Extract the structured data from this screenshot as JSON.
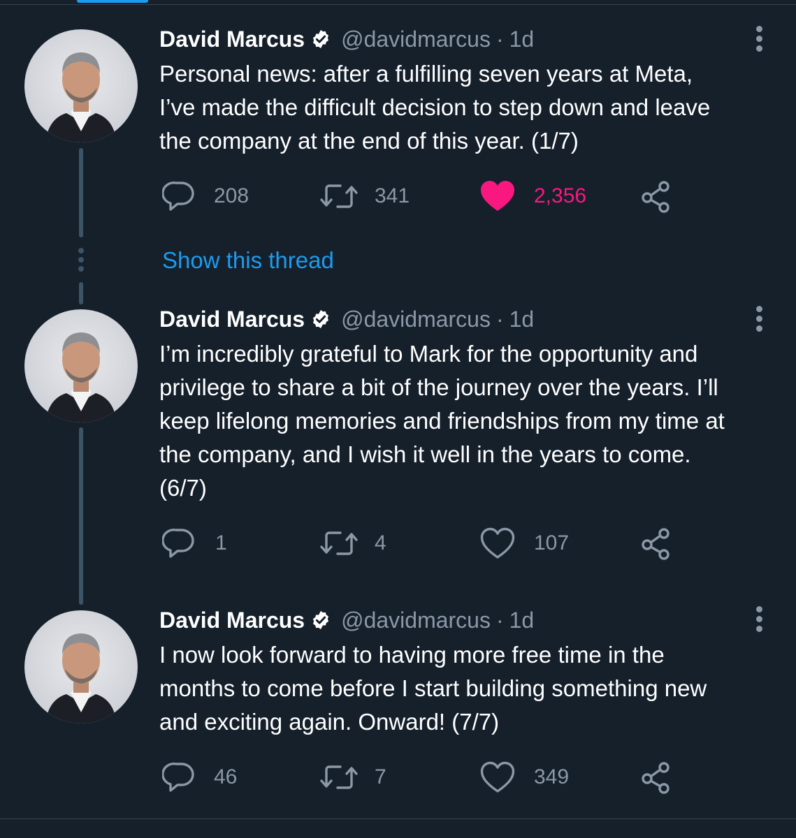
{
  "thread": {
    "show_thread_label": "Show this thread"
  },
  "tweets": [
    {
      "author_name": "David Marcus",
      "handle": "@davidmarcus",
      "separator": "·",
      "time": "1d",
      "text": "Personal news: after a fulfilling seven years at Meta,\nI’ve made the difficult decision to step down and leave\nthe company at the end of this year. (1/7)",
      "reply_count": "208",
      "retweet_count": "341",
      "like_count": "2,356",
      "liked": true
    },
    {
      "author_name": "David Marcus",
      "handle": "@davidmarcus",
      "separator": "·",
      "time": "1d",
      "text": "I’m incredibly grateful to Mark for the opportunity and\nprivilege to share a bit of the journey over the years. I’ll\nkeep lifelong memories and friendships from my time at\nthe company, and I wish it well in the years to come.\n(6/7)",
      "reply_count": "1",
      "retweet_count": "4",
      "like_count": "107",
      "liked": false
    },
    {
      "author_name": "David Marcus",
      "handle": "@davidmarcus",
      "separator": "·",
      "time": "1d",
      "text": "I now look forward to having more free time in the\nmonths to come before I start building something new\nand exciting again. Onward! (7/7)",
      "reply_count": "46",
      "retweet_count": "7",
      "like_count": "349",
      "liked": false
    }
  ],
  "colors": {
    "background": "#15202b",
    "secondary_text": "#8b98a5",
    "link": "#1d9bf0",
    "like": "#f91880",
    "thread_line": "#3d5466"
  },
  "icons": {
    "reply": "reply-icon",
    "retweet": "retweet-icon",
    "like": "heart-icon",
    "share": "share-icon",
    "more": "more-icon",
    "verified": "verified-badge-icon"
  }
}
